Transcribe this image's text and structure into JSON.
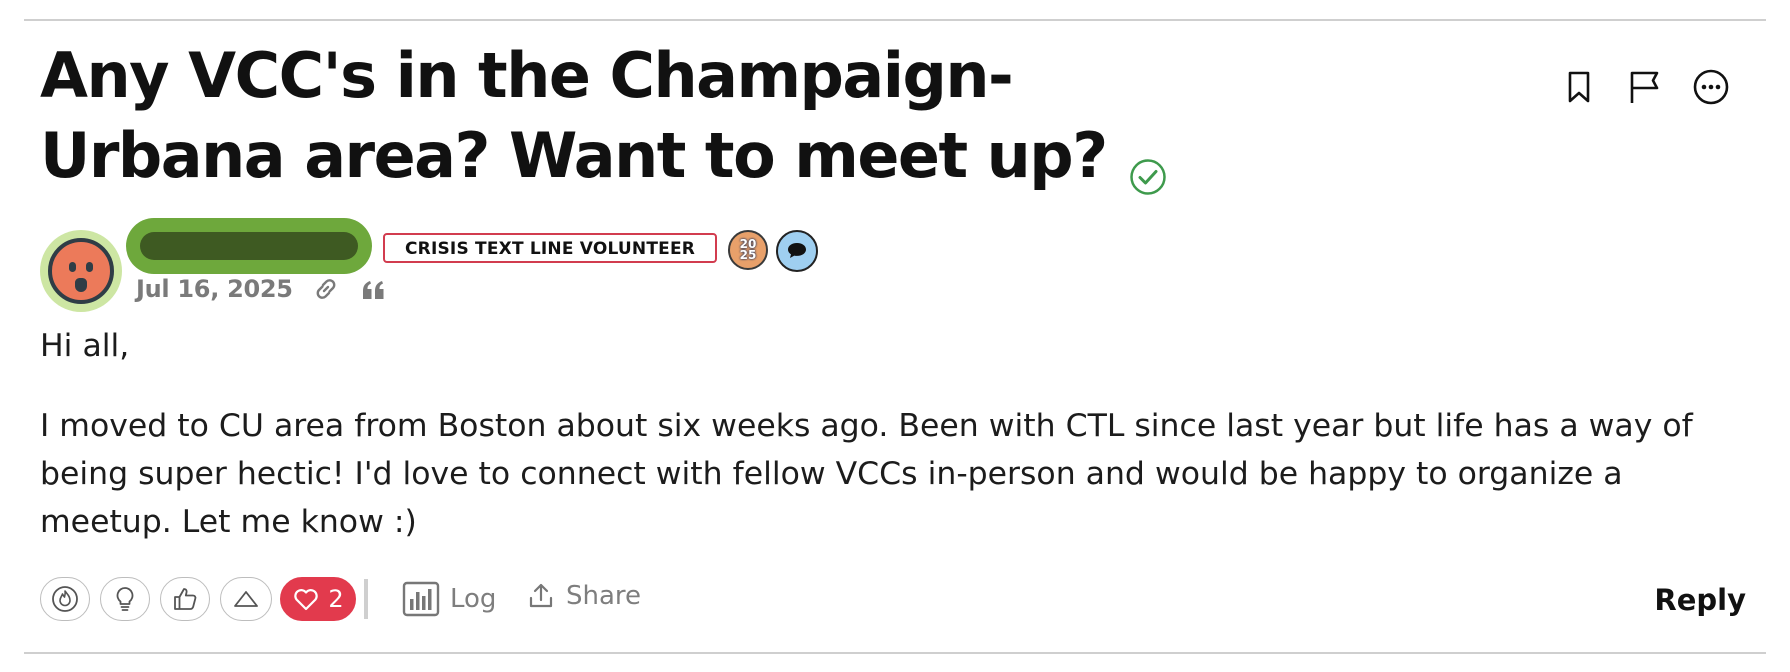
{
  "post": {
    "title_line1": "Any VCC's in the Champaign-",
    "title_line2": "Urbana area? Want to meet up?",
    "author_role_badge": "CRISIS TEXT LINE VOLUNTEER",
    "year_badge_top": "20",
    "year_badge_bottom": "25",
    "date": "Jul 16, 2025",
    "body_greeting": "Hi all,",
    "body_paragraph": "I moved to CU area from Boston about six weeks ago. Been with CTL since last year but life has a way of being super hectic! I'd love to connect with fellow VCCs in-person and would be happy to organize a meetup. Let me know :)"
  },
  "icons": {
    "title": "solved-check-icon",
    "top_actions": [
      "bookmark-icon",
      "flag-icon",
      "more-options-icon"
    ],
    "meta": [
      "link-icon",
      "quote-icon"
    ],
    "reactions": [
      "fire-icon",
      "lightbulb-icon",
      "thumbs-up-icon",
      "upvote-icon",
      "heart-icon"
    ]
  },
  "footer": {
    "heart_count": "2",
    "log_label": "Log",
    "share_label": "Share",
    "reply_label": "Reply"
  },
  "colors": {
    "accent_green": "#6ea83c",
    "badge_red": "#d23c4f",
    "heart_red": "#e23a4d",
    "solved_green": "#3e9a4c",
    "muted_gray": "#7e7e7e"
  }
}
